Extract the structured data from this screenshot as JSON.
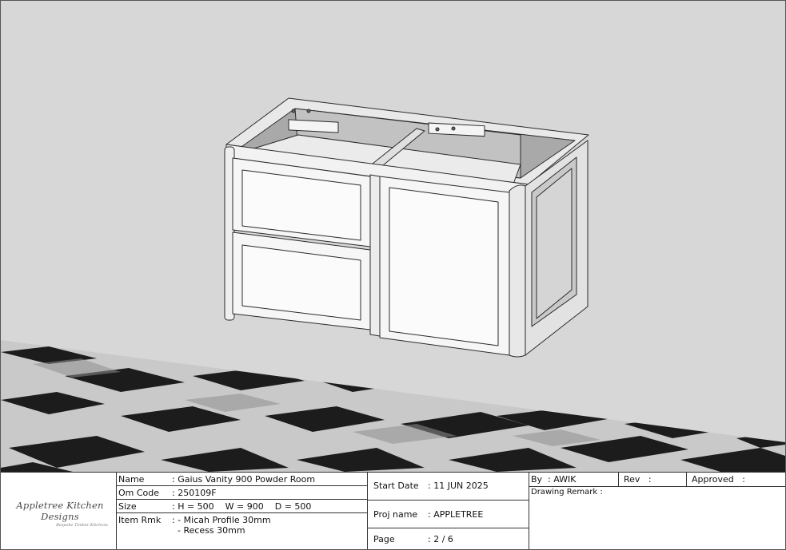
{
  "logo": {
    "name": "Appletree Kitchen Designs",
    "tagline": "Bespoke Timber Kitchens"
  },
  "fields": {
    "name_label": "Name",
    "name_value": ": Gaius Vanity 900 Powder Room",
    "om_code_label": "Om Code",
    "om_code_value": ": 250109F",
    "size_label": "Size",
    "size_value": ": H = 500    W = 900    D = 500",
    "item_rmk_label": "Item Rmk",
    "item_rmk_line1": ": - Micah Profile 30mm",
    "item_rmk_line2": "  - Recess 30mm",
    "start_date_label": "Start Date",
    "start_date_value": ": 11 JUN 2025",
    "proj_name_label": "Proj name",
    "proj_name_value": ": APPLETREE",
    "page_label": "Page",
    "page_value": ": 2 / 6",
    "by_label": "By  : AWIK",
    "rev_label": "Rev   :",
    "approved_label": "Approved   :",
    "drawing_remark_label": "Drawing Remark :"
  }
}
